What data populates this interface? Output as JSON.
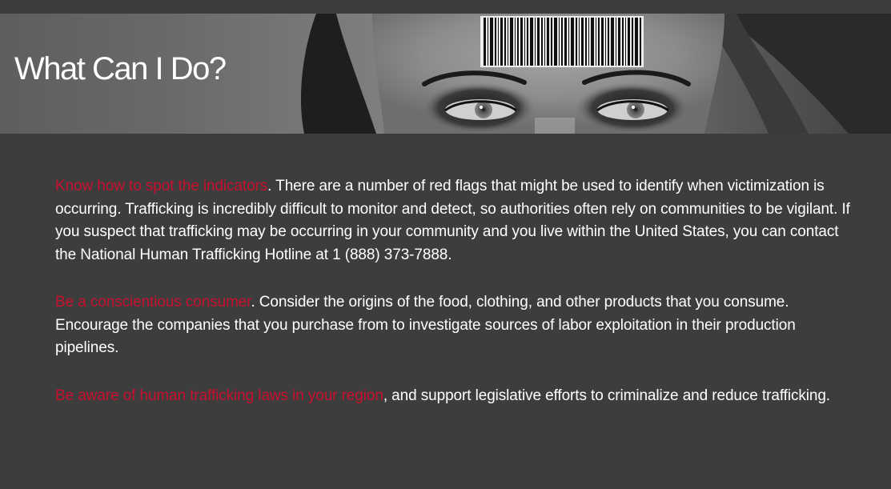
{
  "banner": {
    "title": "What Can I Do?",
    "image": "woman-with-barcode-forehead-photo"
  },
  "colors": {
    "background": "#3d3d3d",
    "text": "#ffffff",
    "link": "#c8102e"
  },
  "sections": [
    {
      "link_text": "Know how to spot the indicators",
      "body": ". There are a number of red flags that might be used to identify when victimization is occurring. Trafficking is incredibly difficult to monitor and detect, so authorities often rely on communities to be vigilant. If you suspect that trafficking may be occurring in your community and you live within the United States, you can contact the National Human Trafficking Hotline at 1 (888) 373-7888."
    },
    {
      "link_text": "Be a conscientious consumer",
      "body": ". Consider the origins of the food, clothing, and other products that you consume. Encourage the companies that you purchase from to investigate sources of labor exploitation in their production pipelines."
    },
    {
      "link_text": "Be aware of human trafficking laws in your region",
      "body": ", and support legislative efforts to criminalize and reduce trafficking."
    }
  ]
}
